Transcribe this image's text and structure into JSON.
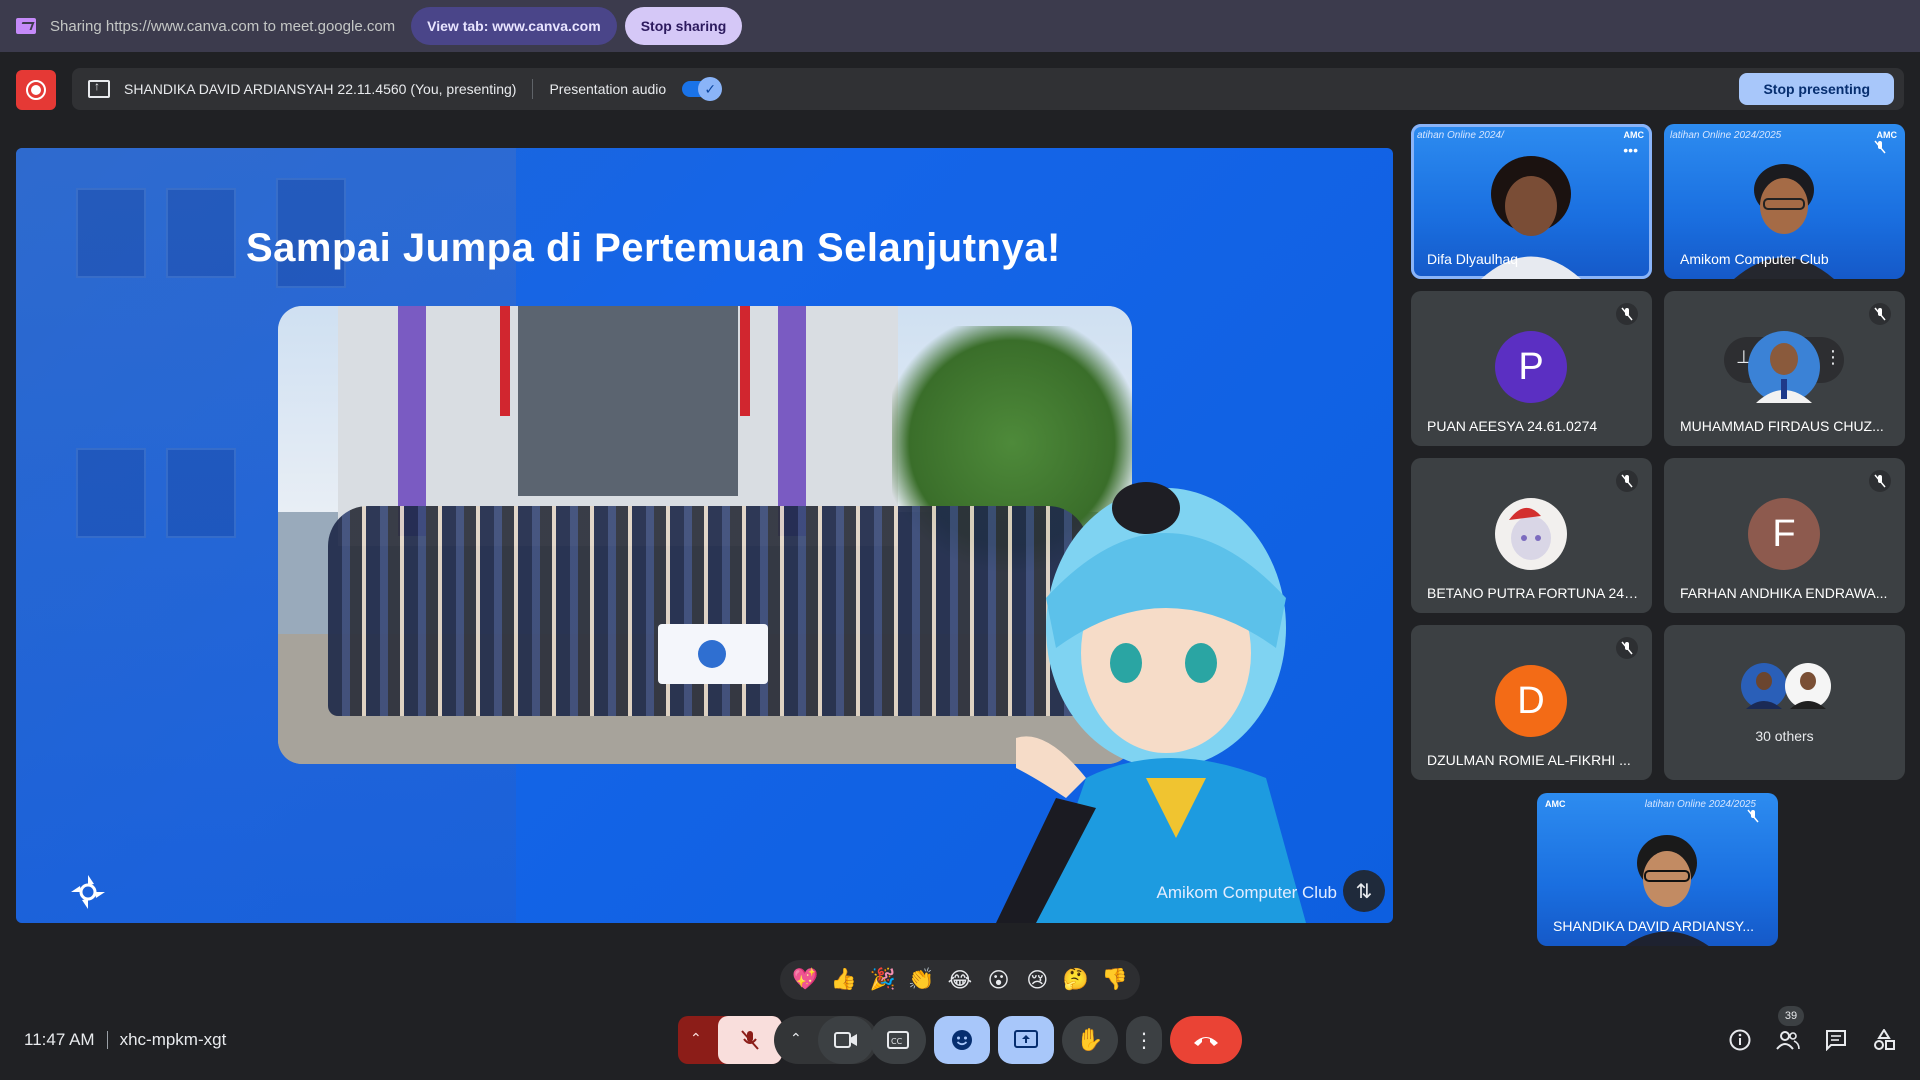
{
  "share_bar": {
    "text": "Sharing https://www.canva.com to meet.google.com",
    "view_tab_label": "View tab: www.canva.com",
    "stop_sharing_label": "Stop sharing"
  },
  "presenting_bar": {
    "presenter": "SHANDIKA DAVID ARDIANSYAH 22.11.4560 (You, presenting)",
    "audio_label": "Presentation audio",
    "audio_on": true,
    "stop_presenting_label": "Stop presenting"
  },
  "slide": {
    "title": "Sampai Jumpa di Pertemuan Selanjutnya!",
    "footer": "Amikom Computer Club"
  },
  "participants": [
    {
      "name": "Difa Dlyaulhaq",
      "kind": "video",
      "banner": "atihan Online 2024/",
      "badge": "AMC"
    },
    {
      "name": "Amikom Computer Club",
      "kind": "video",
      "banner": "latihan Online 2024/2025",
      "badge": "AMC"
    },
    {
      "name": "PUAN AEESYA 24.61.0274",
      "kind": "avatar",
      "initial": "P",
      "color": "#5b2fc2"
    },
    {
      "name": "MUHAMMAD FIRDAUS CHUZ...",
      "kind": "photo"
    },
    {
      "name": "BETANO PUTRA FORTUNA 24....",
      "kind": "photo"
    },
    {
      "name": "FARHAN ANDHIKA ENDRAWA...",
      "kind": "avatar",
      "initial": "F",
      "color": "#8d5a4e"
    },
    {
      "name": "DZULMAN ROMIE AL-FIKRHI ...",
      "kind": "avatar",
      "initial": "D",
      "color": "#f36b16"
    },
    {
      "name": "30 others",
      "kind": "group"
    }
  ],
  "self_view": {
    "name": "SHANDIKA DAVID ARDIANSY...",
    "banner": "latihan Online 2024/2025",
    "badge": "AMC"
  },
  "reactions": [
    "💖",
    "👍",
    "🎉",
    "👏",
    "😂",
    "😮",
    "😢",
    "🤔",
    "👎"
  ],
  "footer": {
    "time": "11:47 AM",
    "meeting_code": "xhc-mpkm-xgt",
    "people_count": "39"
  },
  "colors": {
    "accent": "#8ab4f8",
    "end_call": "#ea4335",
    "mic_off_bg": "#f9dedc",
    "active_btn": "#a8c7fa"
  }
}
